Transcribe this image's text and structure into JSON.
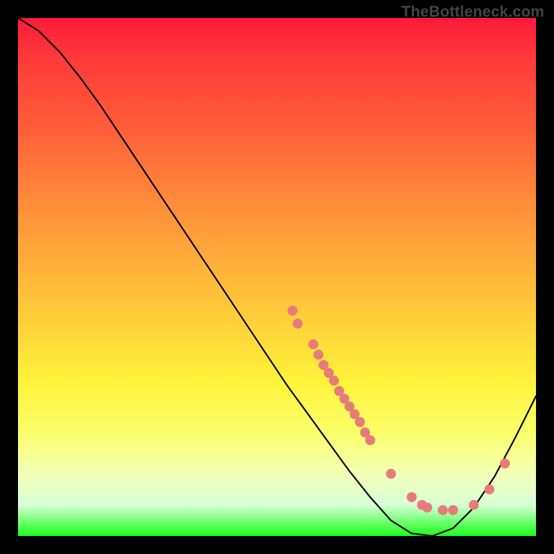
{
  "watermark": "TheBottleneck.com",
  "chart_data": {
    "type": "line",
    "title": "",
    "xlabel": "",
    "ylabel": "",
    "xlim": [
      0,
      100
    ],
    "ylim": [
      0,
      100
    ],
    "grid": false,
    "legend": false,
    "series": [
      {
        "name": "curve",
        "x": [
          0,
          4,
          8,
          12,
          16,
          20,
          24,
          28,
          32,
          36,
          40,
          44,
          48,
          52,
          56,
          60,
          64,
          68,
          72,
          76,
          80,
          84,
          88,
          92,
          96,
          100
        ],
        "y": [
          100,
          97.5,
          93.5,
          88.5,
          83.0,
          77.0,
          71.0,
          65.0,
          59.0,
          53.0,
          47.0,
          41.0,
          35.0,
          29.0,
          23.5,
          18.0,
          12.5,
          7.5,
          3.0,
          0.5,
          0.0,
          1.5,
          5.5,
          11.5,
          19.0,
          27.0
        ]
      }
    ],
    "scatter_points": [
      {
        "x": 53,
        "y": 43.5
      },
      {
        "x": 54,
        "y": 41
      },
      {
        "x": 57,
        "y": 37
      },
      {
        "x": 58,
        "y": 35
      },
      {
        "x": 59,
        "y": 33
      },
      {
        "x": 60,
        "y": 31.5
      },
      {
        "x": 61,
        "y": 30
      },
      {
        "x": 62,
        "y": 28
      },
      {
        "x": 63,
        "y": 26.5
      },
      {
        "x": 64,
        "y": 25
      },
      {
        "x": 65,
        "y": 23.5
      },
      {
        "x": 66,
        "y": 22
      },
      {
        "x": 67,
        "y": 20
      },
      {
        "x": 68,
        "y": 18.5
      },
      {
        "x": 72,
        "y": 12
      },
      {
        "x": 76,
        "y": 7.5
      },
      {
        "x": 78,
        "y": 6
      },
      {
        "x": 79,
        "y": 5.5
      },
      {
        "x": 82,
        "y": 5
      },
      {
        "x": 84,
        "y": 5
      },
      {
        "x": 88,
        "y": 6
      },
      {
        "x": 91,
        "y": 9
      },
      {
        "x": 94,
        "y": 14
      }
    ]
  },
  "colors": {
    "background": "#000000",
    "point": "#e77b7a",
    "curve": "#000000"
  }
}
